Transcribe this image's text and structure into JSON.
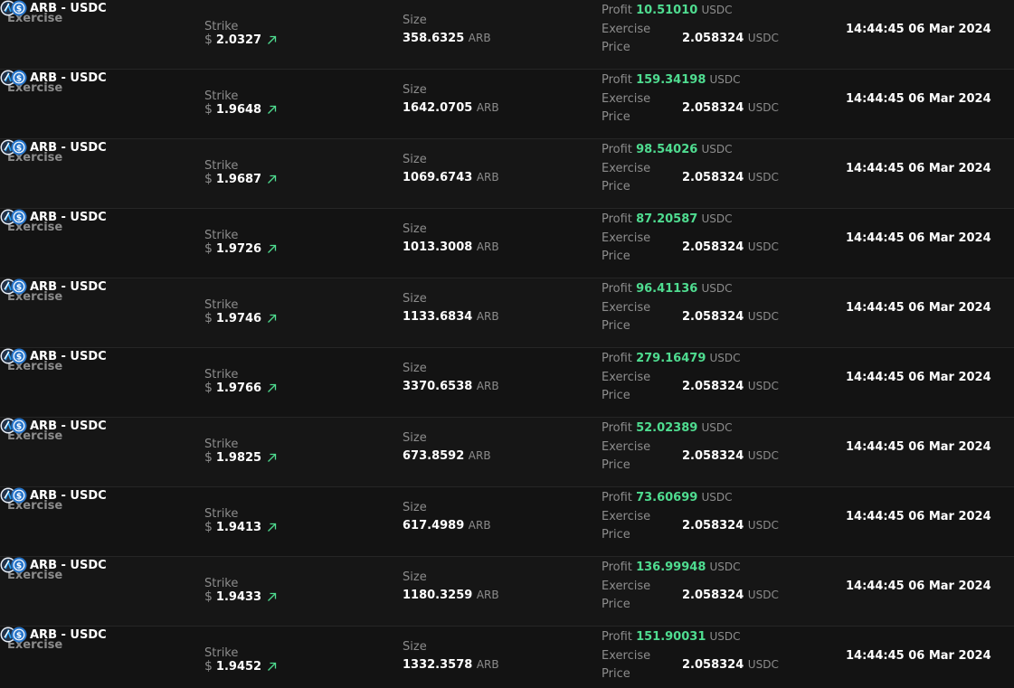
{
  "labels": {
    "strike": "Strike",
    "size": "Size",
    "profit": "Profit",
    "exercise_line1": "Exercise",
    "exercise_line2": "Price",
    "currency_symbol": "$"
  },
  "colors": {
    "profit_green": "#4fdc90",
    "background": "#141414",
    "muted": "#8c8c8c"
  },
  "rows": [
    {
      "type": "Exercise",
      "pair": "ARB - USDC",
      "strike": "2.0327",
      "size": "358.6325",
      "size_unit": "ARB",
      "profit": "10.51010",
      "profit_unit": "USDC",
      "exercise_price": "2.058324",
      "exercise_unit": "USDC",
      "time": "14:44:45 06 Mar 2024"
    },
    {
      "type": "Exercise",
      "pair": "ARB - USDC",
      "strike": "1.9648",
      "size": "1642.0705",
      "size_unit": "ARB",
      "profit": "159.34198",
      "profit_unit": "USDC",
      "exercise_price": "2.058324",
      "exercise_unit": "USDC",
      "time": "14:44:45 06 Mar 2024"
    },
    {
      "type": "Exercise",
      "pair": "ARB - USDC",
      "strike": "1.9687",
      "size": "1069.6743",
      "size_unit": "ARB",
      "profit": "98.54026",
      "profit_unit": "USDC",
      "exercise_price": "2.058324",
      "exercise_unit": "USDC",
      "time": "14:44:45 06 Mar 2024"
    },
    {
      "type": "Exercise",
      "pair": "ARB - USDC",
      "strike": "1.9726",
      "size": "1013.3008",
      "size_unit": "ARB",
      "profit": "87.20587",
      "profit_unit": "USDC",
      "exercise_price": "2.058324",
      "exercise_unit": "USDC",
      "time": "14:44:45 06 Mar 2024"
    },
    {
      "type": "Exercise",
      "pair": "ARB - USDC",
      "strike": "1.9746",
      "size": "1133.6834",
      "size_unit": "ARB",
      "profit": "96.41136",
      "profit_unit": "USDC",
      "exercise_price": "2.058324",
      "exercise_unit": "USDC",
      "time": "14:44:45 06 Mar 2024"
    },
    {
      "type": "Exercise",
      "pair": "ARB - USDC",
      "strike": "1.9766",
      "size": "3370.6538",
      "size_unit": "ARB",
      "profit": "279.16479",
      "profit_unit": "USDC",
      "exercise_price": "2.058324",
      "exercise_unit": "USDC",
      "time": "14:44:45 06 Mar 2024"
    },
    {
      "type": "Exercise",
      "pair": "ARB - USDC",
      "strike": "1.9825",
      "size": "673.8592",
      "size_unit": "ARB",
      "profit": "52.02389",
      "profit_unit": "USDC",
      "exercise_price": "2.058324",
      "exercise_unit": "USDC",
      "time": "14:44:45 06 Mar 2024"
    },
    {
      "type": "Exercise",
      "pair": "ARB - USDC",
      "strike": "1.9413",
      "size": "617.4989",
      "size_unit": "ARB",
      "profit": "73.60699",
      "profit_unit": "USDC",
      "exercise_price": "2.058324",
      "exercise_unit": "USDC",
      "time": "14:44:45 06 Mar 2024"
    },
    {
      "type": "Exercise",
      "pair": "ARB - USDC",
      "strike": "1.9433",
      "size": "1180.3259",
      "size_unit": "ARB",
      "profit": "136.99948",
      "profit_unit": "USDC",
      "exercise_price": "2.058324",
      "exercise_unit": "USDC",
      "time": "14:44:45 06 Mar 2024"
    },
    {
      "type": "Exercise",
      "pair": "ARB - USDC",
      "strike": "1.9452",
      "size": "1332.3578",
      "size_unit": "ARB",
      "profit": "151.90031",
      "profit_unit": "USDC",
      "exercise_price": "2.058324",
      "exercise_unit": "USDC",
      "time": "14:44:45 06 Mar 2024"
    }
  ]
}
